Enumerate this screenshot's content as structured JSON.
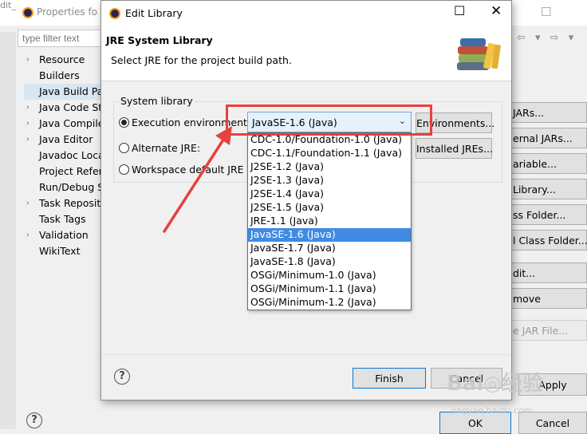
{
  "background_window": {
    "title_prefix": "dit_",
    "title": "Properties fo",
    "minimize": "—",
    "maximize": "☐",
    "filter_placeholder": "type filter text",
    "tree": [
      {
        "label": "Resource",
        "expandable": true
      },
      {
        "label": "Builders",
        "expandable": false
      },
      {
        "label": "Java Build Pa",
        "expandable": false,
        "selected": true
      },
      {
        "label": "Java Code St",
        "expandable": true
      },
      {
        "label": "Java Compile",
        "expandable": true
      },
      {
        "label": "Java Editor",
        "expandable": true
      },
      {
        "label": "Javadoc Loca",
        "expandable": false
      },
      {
        "label": "Project Refer",
        "expandable": false
      },
      {
        "label": "Run/Debug S",
        "expandable": false
      },
      {
        "label": "Task Reposit",
        "expandable": true
      },
      {
        "label": "Task Tags",
        "expandable": false
      },
      {
        "label": "Validation",
        "expandable": true
      },
      {
        "label": "WikiText",
        "expandable": false
      }
    ],
    "nav_arrows": "⇦ ▾ ⇨ ▾",
    "right_buttons": [
      {
        "label": "JARs...",
        "disabled": false
      },
      {
        "label": "ernal JARs...",
        "disabled": false
      },
      {
        "label": "ariable...",
        "disabled": false
      },
      {
        "label": "Library...",
        "disabled": false
      },
      {
        "label": "ss Folder...",
        "disabled": false
      },
      {
        "label": "l Class Folder...",
        "disabled": false
      },
      {
        "label": "dit...",
        "disabled": false
      },
      {
        "label": "move",
        "disabled": false
      },
      {
        "label": "e JAR File...",
        "disabled": true
      }
    ],
    "apply_label": "Apply",
    "ok_label": "OK",
    "cancel_label": "Cancel",
    "help": "?"
  },
  "dialog": {
    "title": "Edit Library",
    "minimize": "—",
    "maximize": "☐",
    "close": "✕",
    "banner_title": "JRE System Library",
    "banner_subtitle": "Select JRE for the project build path.",
    "group_label": "System library",
    "radio_execution": "Execution environment:",
    "radio_alternate": "Alternate JRE:",
    "radio_workspace": "Workspace default JRE (",
    "selected_env": "JavaSE-1.6 (Java)",
    "combo_arrow": "⌄",
    "environments_button": "Environments...",
    "installed_jres_button": "Installed JREs...",
    "dropdown_options": [
      "CDC-1.0/Foundation-1.0 (Java)",
      "CDC-1.1/Foundation-1.1 (Java)",
      "J2SE-1.2 (Java)",
      "J2SE-1.3 (Java)",
      "J2SE-1.4 (Java)",
      "J2SE-1.5 (Java)",
      "JRE-1.1 (Java)",
      "JavaSE-1.6 (Java)",
      "JavaSE-1.7 (Java)",
      "JavaSE-1.8 (Java)",
      "OSGi/Minimum-1.0 (Java)",
      "OSGi/Minimum-1.1 (Java)",
      "OSGi/Minimum-1.2 (Java)"
    ],
    "selected_index": 7,
    "finish_button": "Finish",
    "cancel_button": "Cancel",
    "help": "?"
  },
  "annotation_color": "#e8403e",
  "watermark": {
    "main": "Bai◎经验",
    "sub": "jingyan.baidu.com"
  }
}
